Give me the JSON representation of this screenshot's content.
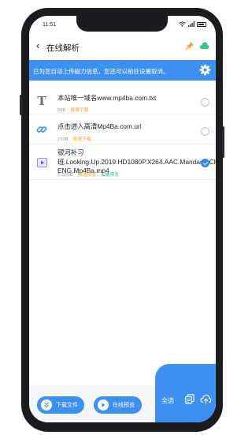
{
  "status": {
    "time": "11:51"
  },
  "header": {
    "back_glyph": "‹",
    "title": "在线解析"
  },
  "banner": {
    "text": "已为您自动上传磁力信息，您还可以前往设置取消。"
  },
  "files": [
    {
      "type": "text",
      "icon_glyph": "T",
      "name": "本站唯一域名www.mp4ba.com.txt",
      "size": "50B",
      "tag1": "极速下载",
      "tag2": "",
      "selected": false
    },
    {
      "type": "link",
      "icon_glyph": "",
      "name": "点击进入高清Mp4Ba.com.url",
      "size": "152B",
      "tag1": "极速下载",
      "tag2": "",
      "selected": false
    },
    {
      "type": "video",
      "icon_glyph": "",
      "name": "银河补习班.Looking.Up.2019.HD1080P.X264.AAC.Mandarin.CHS-ENG.Mp4Ba.mp4",
      "size": "3.22GB",
      "tag1": "极速预览",
      "tag2": "云端预览",
      "selected": true
    }
  ],
  "bottom": {
    "download_label": "下载文件",
    "preview_label": "在线预览",
    "select_all_label": "全选"
  },
  "colors": {
    "accent": "#3d8ff0",
    "tag_orange": "#f0a020",
    "tag_green": "#33c08a"
  },
  "icons": [
    "back-icon",
    "pin-icon",
    "cloud-icon",
    "gear-icon",
    "text-file-icon",
    "link-icon",
    "video-icon",
    "download-icon",
    "play-icon",
    "copy-icon",
    "upload-cloud-icon"
  ]
}
